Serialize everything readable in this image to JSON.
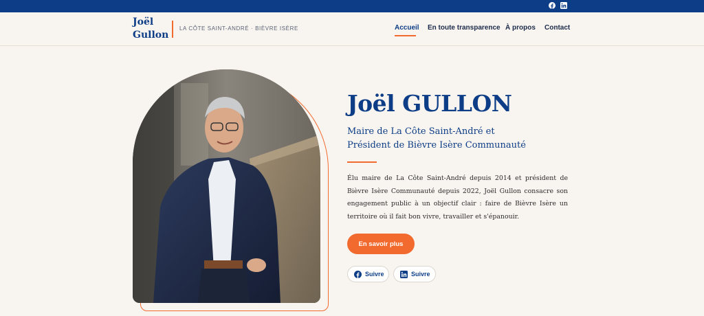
{
  "topbar": {
    "icons": [
      "facebook-icon",
      "linkedin-icon"
    ],
    "color": "#0c3d86"
  },
  "header": {
    "logo_line1": "Joël",
    "logo_line2": "Gullon",
    "tagline": "LA CÔTE SAINT-ANDRÉ · BIÈVRE ISÈRE",
    "nav": [
      {
        "label": "Accueil",
        "active": true
      },
      {
        "label": "En toute transparence",
        "active": false
      },
      {
        "label": "À propos",
        "active": false
      },
      {
        "label": "Contact",
        "active": false
      }
    ]
  },
  "hero": {
    "name": "Joël GULLON",
    "subtitle_line1": "Maire de La Côte Saint-André et",
    "subtitle_line2": "Président de Bièvre Isère Communauté",
    "bio": "Élu maire de La Côte Saint-André depuis 2014 et président de Bièvre Isère Communauté depuis 2022, Joël Gullon consacre son engagement public à un objectif clair : faire de Bièvre Isère un territoire où il fait bon vivre, travailler et s'épanouir.",
    "cta_label": "En savoir plus",
    "follow_facebook": "Suivre",
    "follow_linkedin": "Suivre"
  },
  "colors": {
    "brand_blue": "#0c3d86",
    "accent_orange": "#f26a2e",
    "background": "#f8f4ef"
  }
}
